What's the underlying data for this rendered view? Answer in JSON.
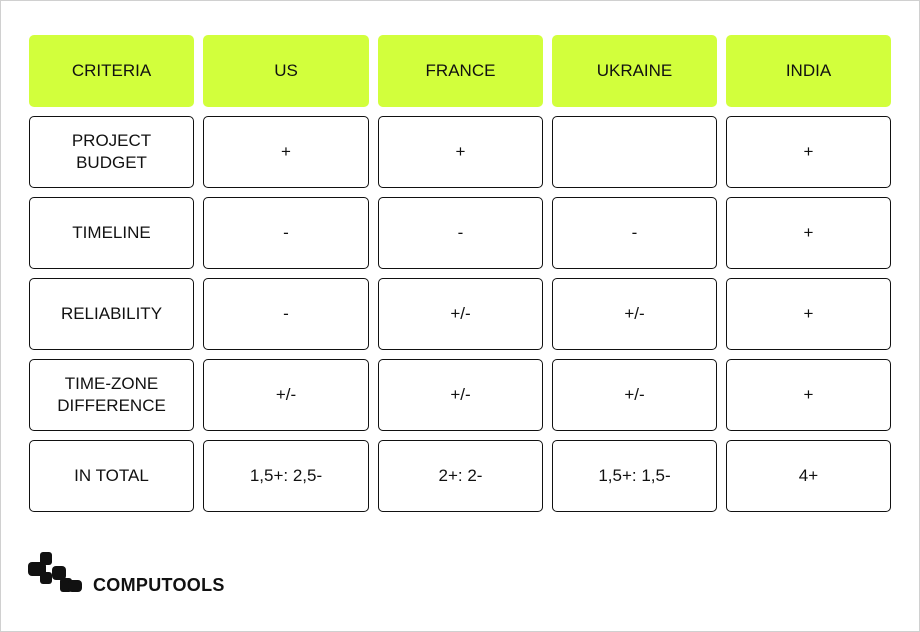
{
  "headers": [
    "CRITERIA",
    "US",
    "FRANCE",
    "UKRAINE",
    "INDIA"
  ],
  "rows": [
    [
      "PROJECT\nBUDGET",
      "+",
      "+",
      "",
      "+"
    ],
    [
      "TIMELINE",
      "-",
      "-",
      "-",
      "+"
    ],
    [
      "RELIABILITY",
      "-",
      "+/-",
      "+/-",
      "+"
    ],
    [
      "TIME-ZONE\nDIFFERENCE",
      "+/-",
      "+/-",
      "+/-",
      "+"
    ],
    [
      "IN TOTAL",
      "1,5+: 2,5-",
      "2+: 2-",
      "1,5+: 1,5-",
      "4+"
    ]
  ],
  "brand": {
    "name": "COMPUTOOLS",
    "logo_icon": "computools-logo-icon"
  },
  "colors": {
    "header_bg": "#d2ff3c",
    "border": "#111111"
  }
}
